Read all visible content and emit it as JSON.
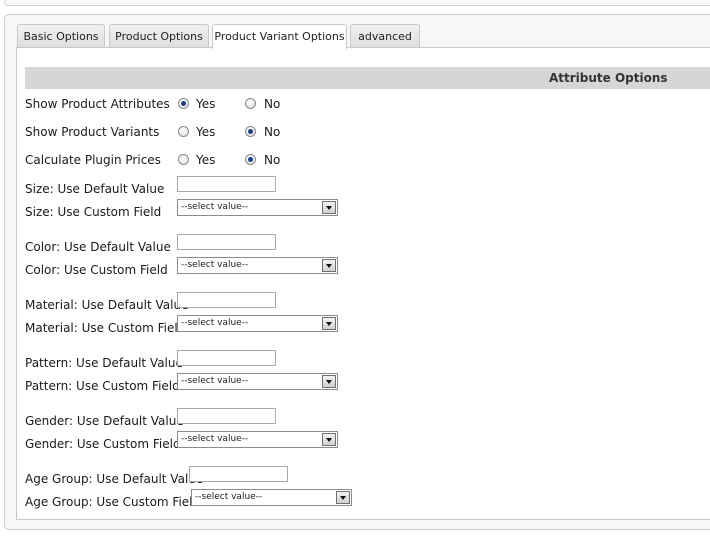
{
  "tabs": [
    {
      "label": "Basic Options",
      "active": false
    },
    {
      "label": "Product Options",
      "active": false
    },
    {
      "label": "Product Variant Options",
      "active": true
    },
    {
      "label": "advanced",
      "active": false
    }
  ],
  "section": {
    "title": "Attribute Options"
  },
  "radio_rows": [
    {
      "label": "Show Product Attributes",
      "yes": "Yes",
      "no": "No",
      "selected": "yes"
    },
    {
      "label": "Show Product Variants",
      "yes": "Yes",
      "no": "No",
      "selected": "no"
    },
    {
      "label": "Calculate Plugin Prices",
      "yes": "Yes",
      "no": "No",
      "selected": "no"
    }
  ],
  "attributes": [
    {
      "default_label": "Size: Use Default Value",
      "custom_label": "Size: Use Custom Field",
      "default_value": "",
      "select_value": "--select value--"
    },
    {
      "default_label": "Color: Use Default Value",
      "custom_label": "Color: Use Custom Field",
      "default_value": "",
      "select_value": "--select value--"
    },
    {
      "default_label": "Material: Use Default Value",
      "custom_label": "Material: Use Custom Field",
      "default_value": "",
      "select_value": "--select value--"
    },
    {
      "default_label": "Pattern: Use Default Value",
      "custom_label": "Pattern: Use Custom Field",
      "default_value": "",
      "select_value": "--select value--"
    },
    {
      "default_label": "Gender: Use Default Value",
      "custom_label": "Gender: Use Custom Field",
      "default_value": "",
      "select_value": "--select value--"
    },
    {
      "default_label": "Age Group: Use Default Value",
      "custom_label": "Age Group: Use Custom Field",
      "default_value": "",
      "select_value": "--select value--"
    }
  ]
}
